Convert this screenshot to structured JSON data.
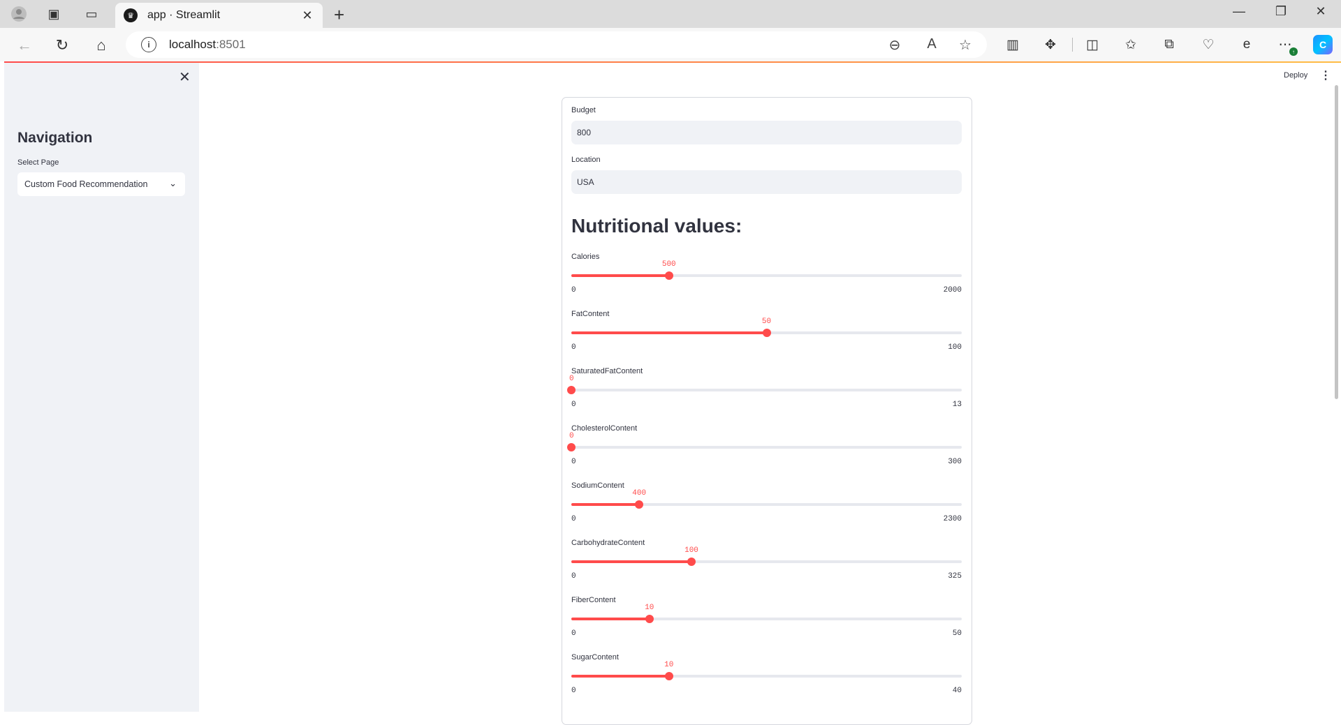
{
  "browser": {
    "tab_title": "app · Streamlit",
    "url_host": "localhost",
    "url_port": ":8501"
  },
  "app": {
    "deploy_label": "Deploy"
  },
  "sidebar": {
    "title": "Navigation",
    "select_label": "Select Page",
    "select_value": "Custom Food Recommendation"
  },
  "form": {
    "budget_label": "Budget",
    "budget_value": "800",
    "location_label": "Location",
    "location_value": "USA",
    "heading": "Nutritional values:",
    "sliders": [
      {
        "label": "Calories",
        "value": 500,
        "min": 0,
        "max": 2000
      },
      {
        "label": "FatContent",
        "value": 50,
        "min": 0,
        "max": 100
      },
      {
        "label": "SaturatedFatContent",
        "value": 0,
        "min": 0,
        "max": 13
      },
      {
        "label": "CholesterolContent",
        "value": 0,
        "min": 0,
        "max": 300
      },
      {
        "label": "SodiumContent",
        "value": 400,
        "min": 0,
        "max": 2300
      },
      {
        "label": "CarbohydrateContent",
        "value": 100,
        "min": 0,
        "max": 325
      },
      {
        "label": "FiberContent",
        "value": 10,
        "min": 0,
        "max": 50
      },
      {
        "label": "SugarContent",
        "value": 10,
        "min": 0,
        "max": 40
      }
    ]
  },
  "colors": {
    "accent": "#ff4b4b",
    "sidebar_bg": "#f0f2f6",
    "input_bg": "#f0f2f6"
  }
}
